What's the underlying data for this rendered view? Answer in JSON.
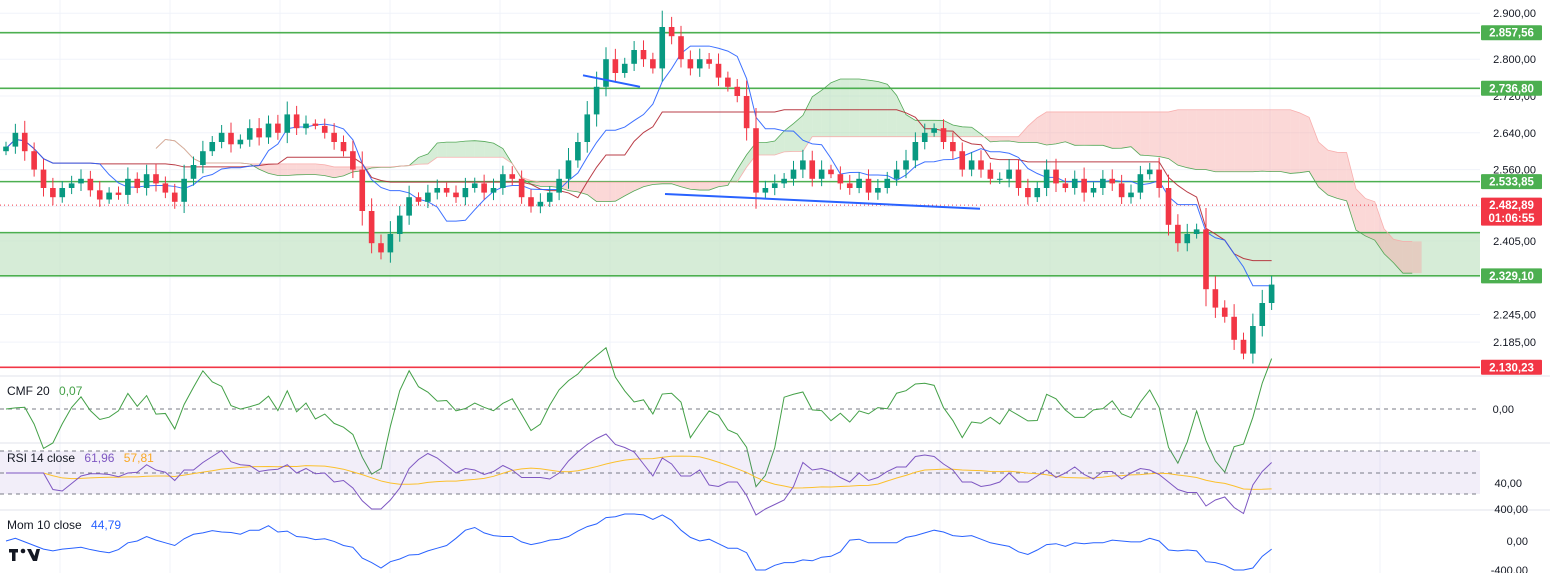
{
  "colors": {
    "up": "#089981",
    "down": "#f23645",
    "level": "#4caf50",
    "support_red": "#f23645",
    "kijun": "#b22833",
    "tenkan": "#2962ff",
    "cloud_green": "#a5d6a7",
    "cloud_red": "#f7a9a7",
    "zone": "#c8e6c9",
    "cmf": "#43a047",
    "rsi": "#7e57c2",
    "rsi_ma": "#fbc02d",
    "mom": "#2962ff",
    "price_line": "#f23645",
    "grid": "#f0f3fa"
  },
  "indicators": {
    "cmf": {
      "name": "CMF 20",
      "value": "0,07"
    },
    "rsi": {
      "name": "RSI 14 close",
      "value": "61,96",
      "ma_value": "57,81"
    },
    "mom": {
      "name": "Mom 10 close",
      "value": "44,79"
    }
  },
  "price_axis": {
    "ticks": [
      "2.900,00",
      "2.800,00",
      "2.720,00",
      "2.640,00",
      "2.560,00",
      "2.405,00",
      "2.245,00",
      "2.185,00"
    ],
    "tags": [
      {
        "label": "2.857,56",
        "color": "#4caf50"
      },
      {
        "label": "2.736,80",
        "color": "#4caf50"
      },
      {
        "label": "2.533,85",
        "color": "#4caf50"
      },
      {
        "label": "2.482,89",
        "sublabel": "01:06:55",
        "color": "#f23645"
      },
      {
        "label": "2.329,10",
        "color": "#4caf50"
      },
      {
        "label": "2.130,23",
        "color": "#f23645"
      }
    ]
  },
  "indicator_axis": {
    "cmf_ticks": [
      "0,00"
    ],
    "rsi_ticks": [
      "40,00"
    ],
    "mom_ticks": [
      "400,00",
      "0,00",
      "-400,00"
    ]
  },
  "logo": "TV",
  "chart_data": {
    "type": "candlestick",
    "ylim": [
      2120,
      2920
    ],
    "levels": [
      2857.56,
      2736.8,
      2533.85,
      2423,
      2329.1,
      2130.23
    ],
    "current_price": 2482.89,
    "countdown": "01:06:55",
    "n_bars": 130,
    "closes": [
      2610,
      2640,
      2600,
      2560,
      2520,
      2500,
      2520,
      2530,
      2540,
      2515,
      2495,
      2510,
      2505,
      2540,
      2520,
      2550,
      2530,
      2510,
      2490,
      2540,
      2570,
      2600,
      2620,
      2640,
      2615,
      2625,
      2650,
      2630,
      2660,
      2640,
      2680,
      2650,
      2660,
      2655,
      2640,
      2620,
      2600,
      2560,
      2470,
      2400,
      2380,
      2420,
      2460,
      2500,
      2490,
      2510,
      2520,
      2510,
      2500,
      2520,
      2530,
      2510,
      2520,
      2550,
      2540,
      2500,
      2480,
      2490,
      2510,
      2540,
      2580,
      2620,
      2680,
      2740,
      2800,
      2770,
      2790,
      2820,
      2800,
      2780,
      2870,
      2850,
      2800,
      2780,
      2800,
      2790,
      2760,
      2740,
      2720,
      2650,
      2510,
      2520,
      2530,
      2540,
      2560,
      2580,
      2540,
      2560,
      2550,
      2530,
      2520,
      2540,
      2510,
      2520,
      2540,
      2560,
      2580,
      2620,
      2640,
      2650,
      2620,
      2600,
      2560,
      2580,
      2560,
      2540,
      2540,
      2560,
      2520,
      2500,
      2520,
      2560,
      2530,
      2520,
      2540,
      2510,
      2520,
      2540,
      2530,
      2500,
      2510,
      2550,
      2560,
      2520,
      2440,
      2400,
      2420,
      2430,
      2300,
      2260,
      2240,
      2190,
      2160,
      2220,
      2270,
      2310
    ],
    "ichimoku_note": "tenkan, kijun and cloud computed from closes",
    "trendlines": [
      {
        "from": [
          583,
          2765
        ],
        "to": [
          640,
          2740
        ]
      },
      {
        "from": [
          665,
          2507
        ],
        "to": [
          980,
          2475
        ]
      }
    ]
  }
}
